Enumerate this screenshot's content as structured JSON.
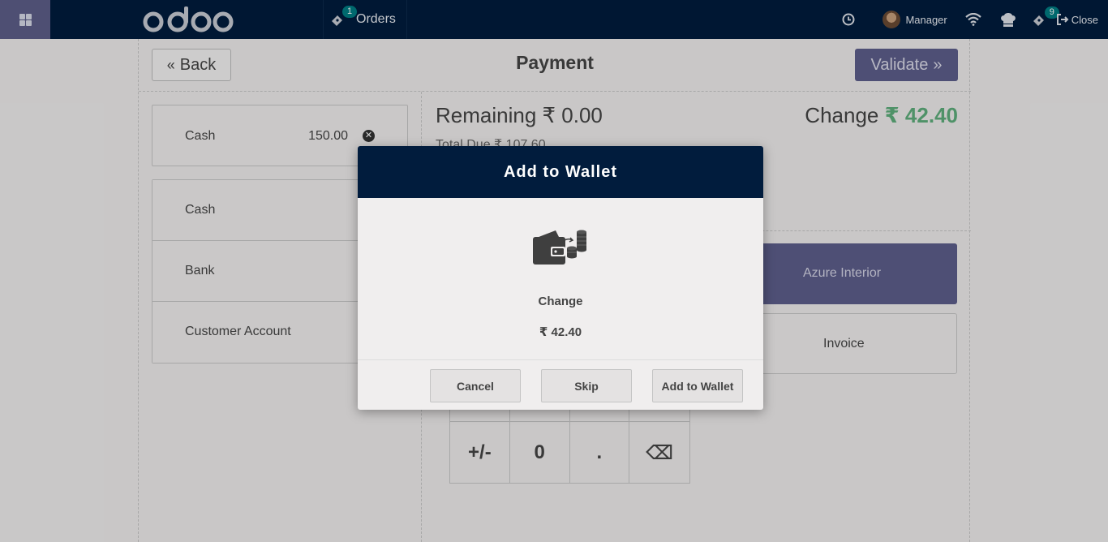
{
  "navbar": {
    "logo_text": "odoo",
    "orders_label": "Orders",
    "orders_count": "1",
    "user_name": "Manager",
    "sync_count": "9",
    "close_label": "Close"
  },
  "payment": {
    "back_label": "Back",
    "title": "Payment",
    "validate_label": "Validate",
    "lines": [
      {
        "name": "Cash",
        "amount": "150.00"
      }
    ],
    "methods": [
      "Cash",
      "Bank",
      "Customer Account"
    ],
    "remaining": "Remaining ₹ 0.00",
    "change_label": "Change",
    "change_value": "₹ 42.40",
    "total_due": "Total Due ₹ 107.60",
    "customer": "Azure Interior",
    "invoice_label": "Invoice",
    "numpad_row2": [
      "+/-",
      "0",
      ".",
      "⌫"
    ]
  },
  "dialog": {
    "title": "Add to Wallet",
    "label": "Change",
    "amount": "₹ 42.40",
    "cancel_label": "Cancel",
    "skip_label": "Skip",
    "add_label": "Add to Wallet"
  },
  "colors": {
    "navbar_bg": "#011c3d",
    "accent": "#5e5f8c",
    "change_green": "#5fae7c",
    "badge_teal": "#017e84"
  }
}
